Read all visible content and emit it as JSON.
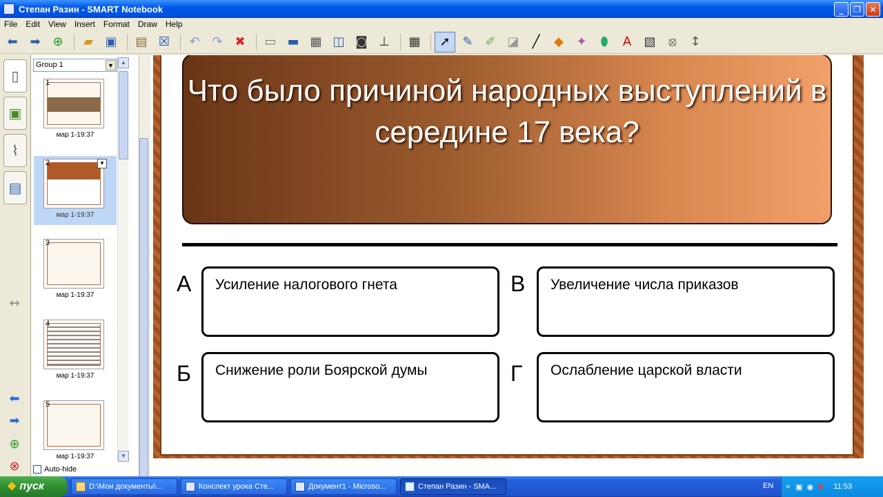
{
  "window": {
    "title": "Степан Разин - SMART Notebook"
  },
  "menu": [
    "File",
    "Edit",
    "View",
    "Insert",
    "Format",
    "Draw",
    "Help"
  ],
  "toolbar": {
    "icons": [
      "back-arrow-icon",
      "forward-arrow-icon",
      "add-page-icon",
      "open-folder-icon",
      "save-icon",
      "paste-icon",
      "delete-page-icon",
      "undo-icon",
      "redo-icon",
      "delete-icon",
      "screen-shade-icon",
      "full-screen-icon",
      "transparent-background-icon",
      "dual-page-icon",
      "screen-capture-icon",
      "document-camera-icon",
      "table-icon",
      "select-icon",
      "pen-icon",
      "creative-pen-icon",
      "eraser-icon",
      "line-icon",
      "shapes-icon",
      "magic-pen-icon",
      "fill-icon",
      "text-icon",
      "properties-icon",
      "measurement-tools-icon",
      "move-toolbar-icon"
    ]
  },
  "sorter": {
    "group": "Group 1",
    "autohide_label": "Auto-hide",
    "thumbnails": [
      {
        "num": "1",
        "date": "мар 1-19:37"
      },
      {
        "num": "2",
        "date": "мар 1-19:37"
      },
      {
        "num": "3",
        "date": "мар 1-19:37"
      },
      {
        "num": "4",
        "date": "мар 1-19:37"
      },
      {
        "num": "5",
        "date": "мар 1-19:37"
      }
    ]
  },
  "slide": {
    "question": "Что  было причиной народных выступлений в середине 17 века?",
    "options": [
      {
        "letter": "А",
        "text": "Усиление налогового гнета"
      },
      {
        "letter": "В",
        "text": "Увеличение числа приказов"
      },
      {
        "letter": "Б",
        "text": "Снижение роли Боярской думы"
      },
      {
        "letter": "Г",
        "text": "Ослабление царской власти"
      }
    ]
  },
  "taskbar": {
    "start": "пуск",
    "tasks": [
      "D:\\Мои документы\\...",
      "Конспект урока Сте...",
      "Документ1 - Microso...",
      "Степан Разин - SMA..."
    ],
    "lang": "EN",
    "clock": "11:53"
  }
}
